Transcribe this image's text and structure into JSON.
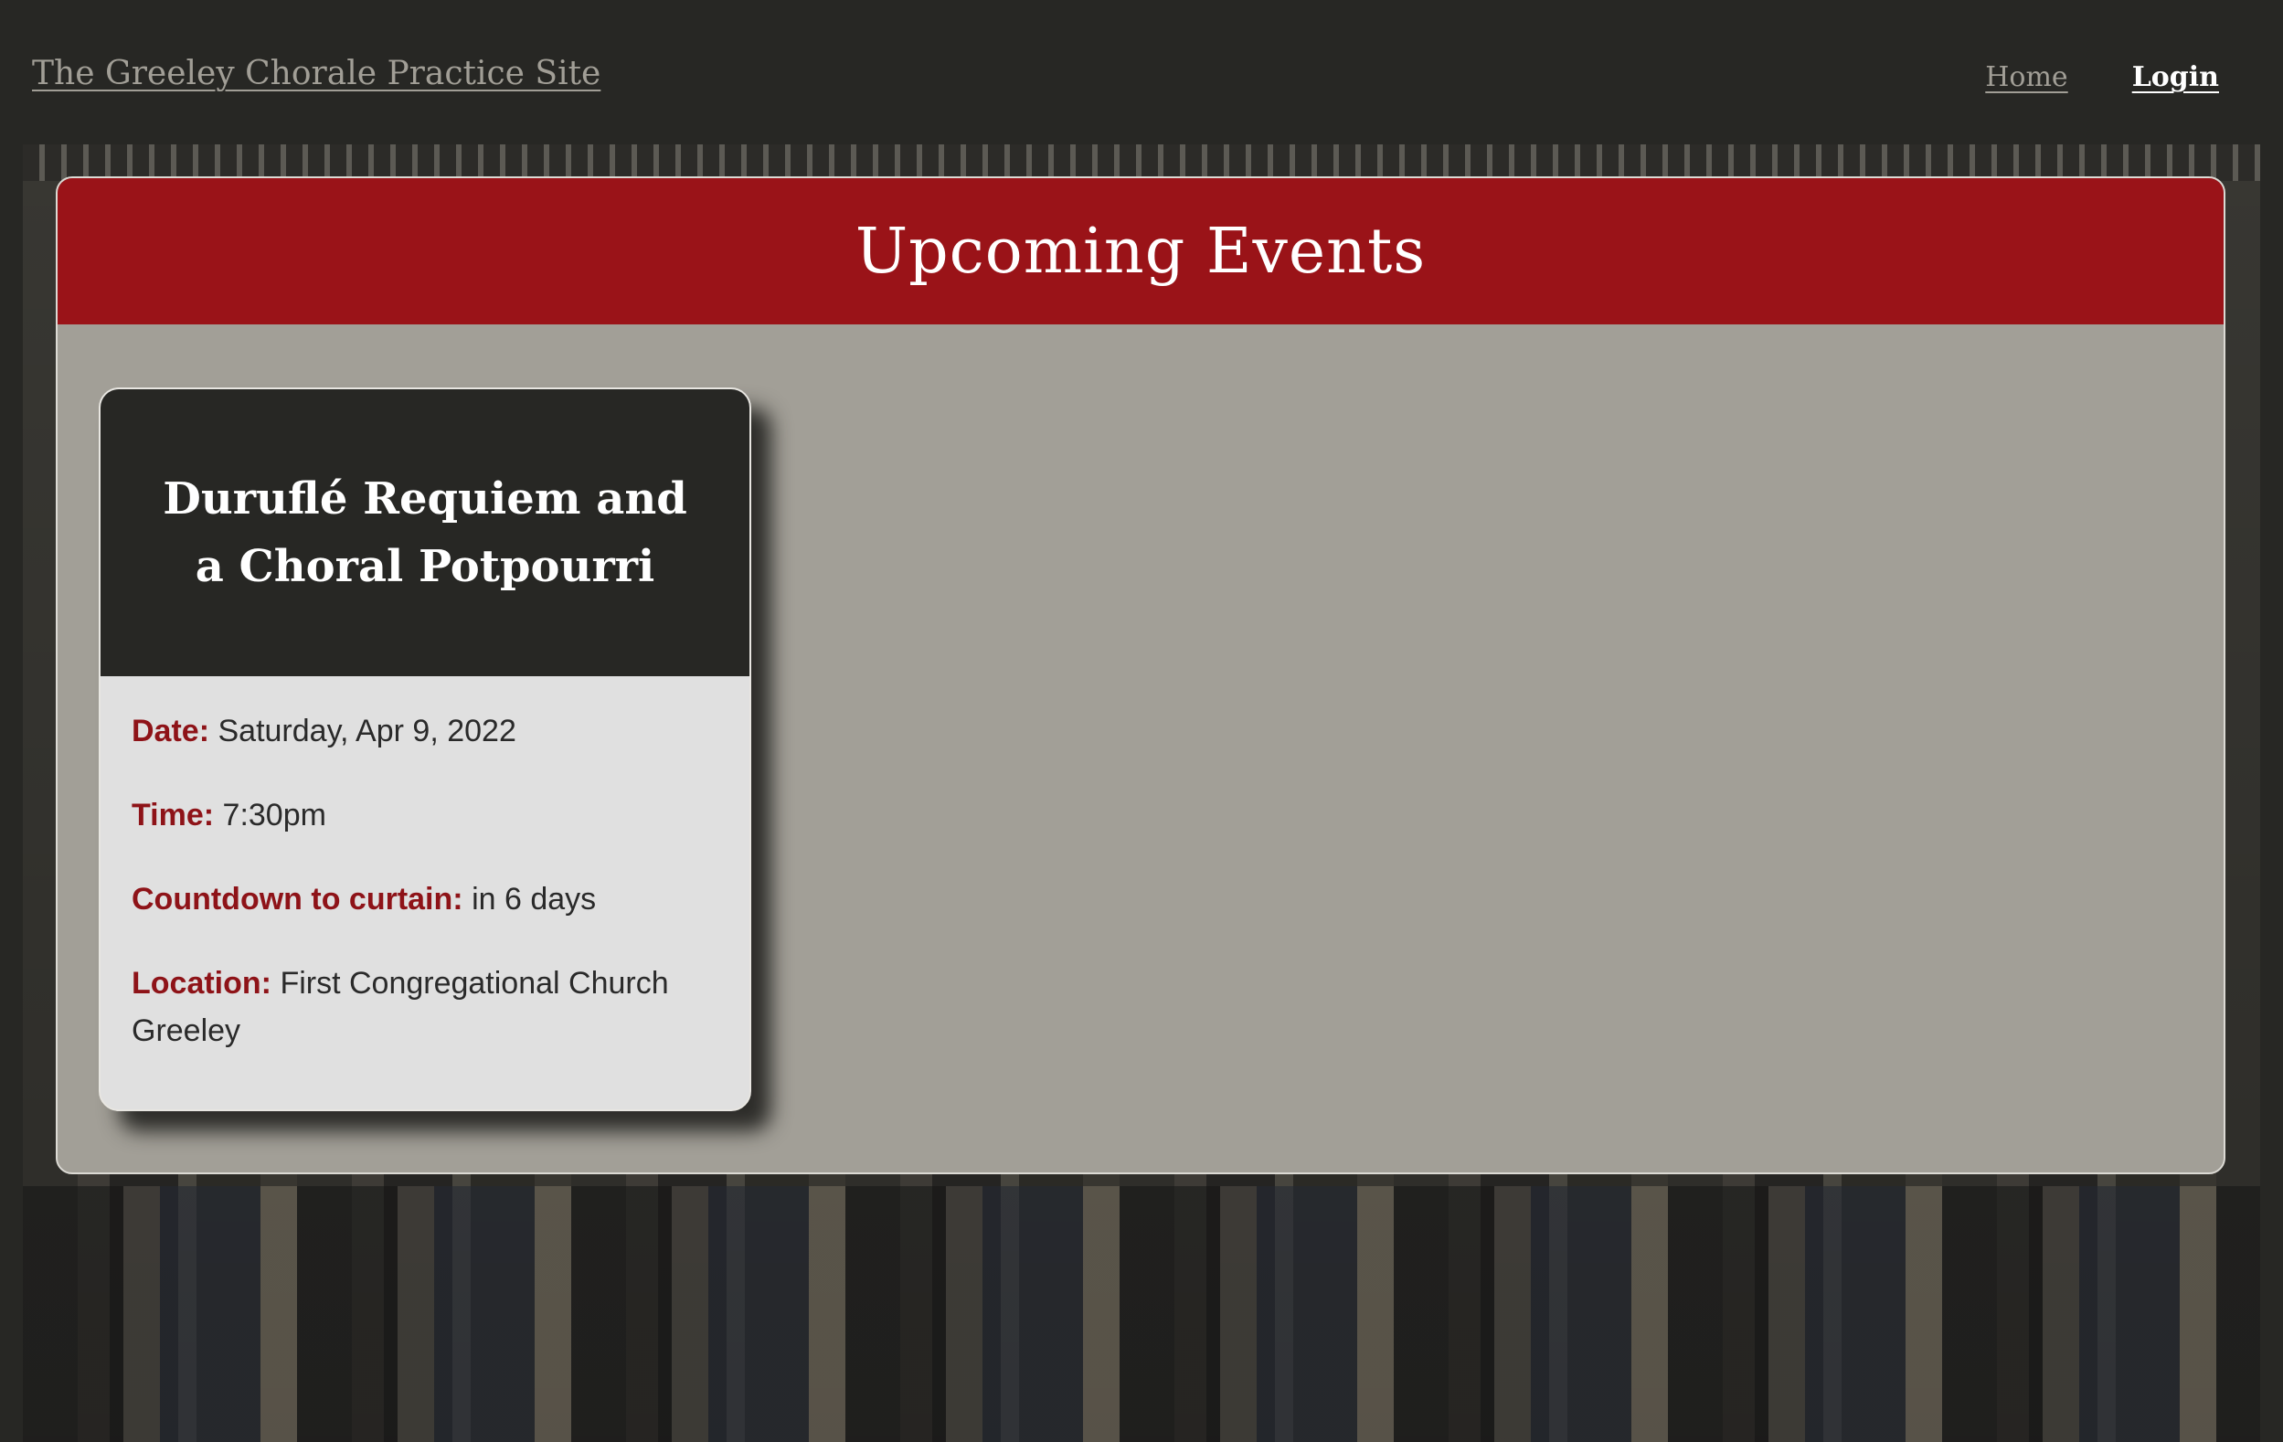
{
  "navbar": {
    "brand": "The Greeley Chorale Practice Site",
    "links": {
      "home": "Home",
      "login": "Login"
    }
  },
  "events_panel": {
    "title": "Upcoming Events",
    "events": [
      {
        "title": "Duruflé Requiem and a Choral Potpourri",
        "date_label": "Date:",
        "date": "Saturday, Apr 9, 2022",
        "time_label": "Time:",
        "time": "7:30pm",
        "countdown_label": "Countdown to curtain:",
        "countdown": "in 6 days",
        "location_label": "Location:",
        "location": "First Congregational Church Greeley"
      }
    ]
  },
  "colors": {
    "navbar_bg": "#272724",
    "panel_header": "#9a1318",
    "panel_bg": "#a29f97",
    "card_body": "#e0e0e0",
    "label_red": "#8e1318"
  }
}
